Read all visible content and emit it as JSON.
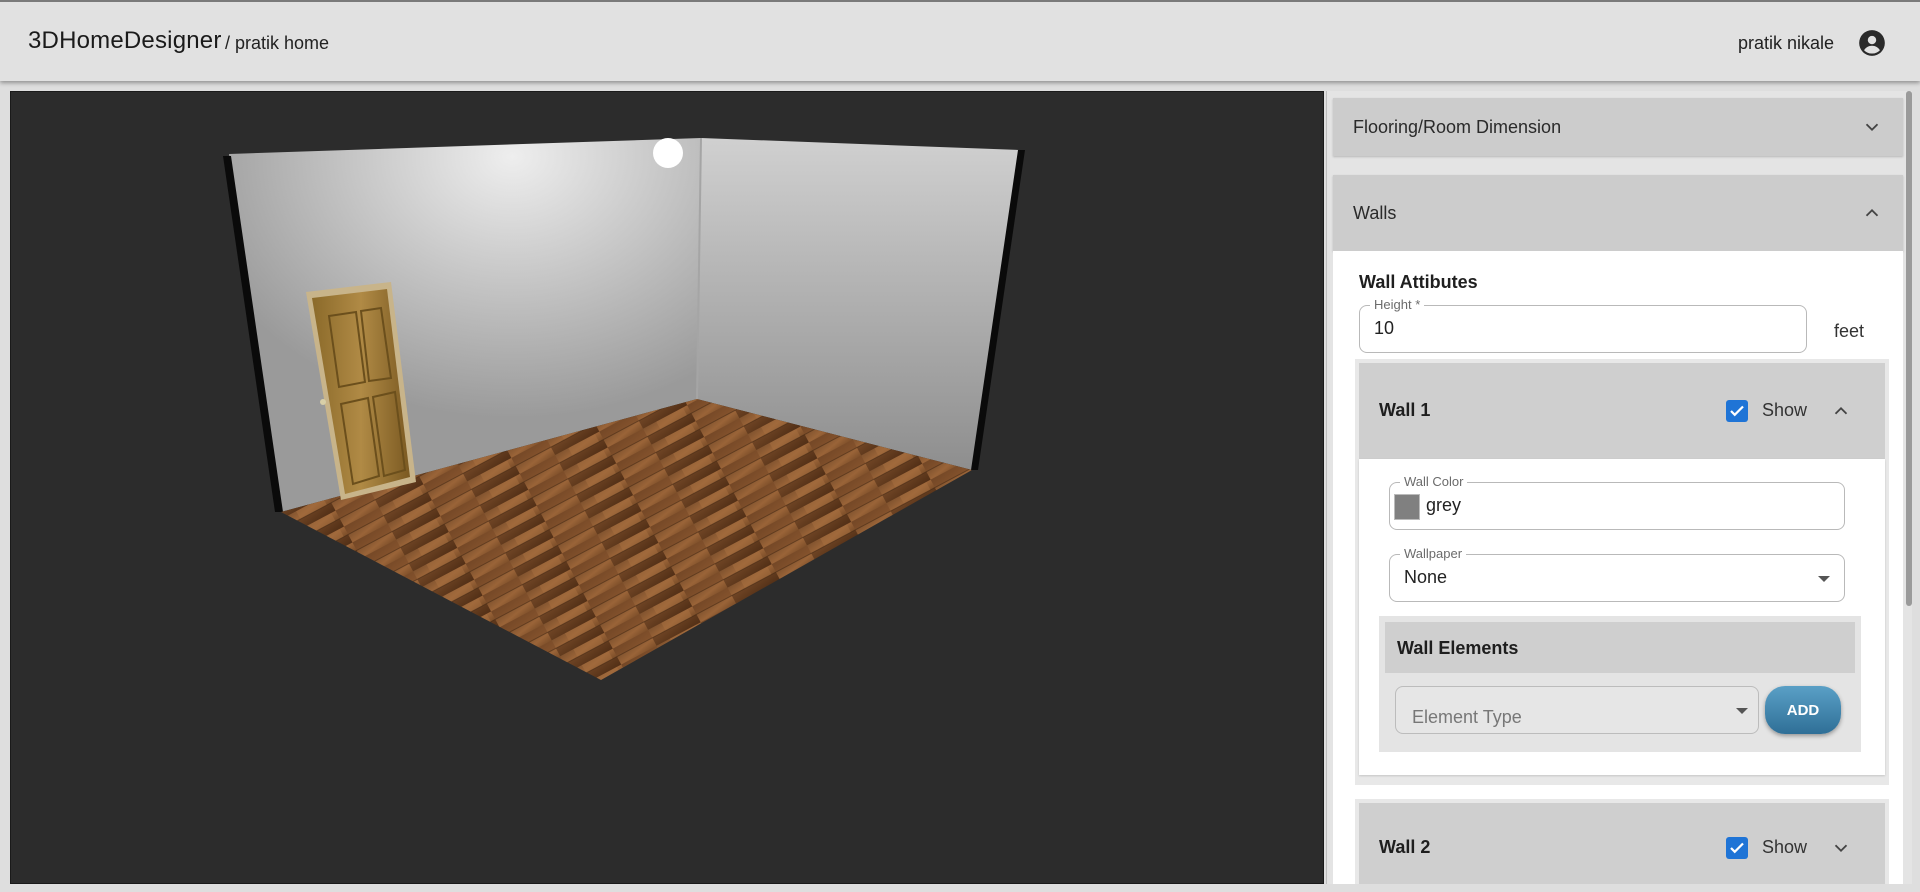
{
  "header": {
    "app_name": "3DHomeDesigner",
    "breadcrumb": "/ pratik home",
    "user_name": "pratik nikale",
    "account_icon": "account-circle-icon"
  },
  "viewport": {
    "description_icons": [
      "light-handle"
    ],
    "scene": "3d-room"
  },
  "panel": {
    "flooring": {
      "title": "Flooring/Room Dimension",
      "expanded": false
    },
    "walls": {
      "title": "Walls",
      "expanded": true,
      "attributes_title": "Wall Attibutes",
      "height": {
        "label": "Height *",
        "value": "10",
        "unit": "feet"
      },
      "items": [
        {
          "title": "Wall 1",
          "show_label": "Show",
          "show_checked": true,
          "expanded": true,
          "color": {
            "label": "Wall Color",
            "value": "grey",
            "swatch": "#808080"
          },
          "wallpaper": {
            "label": "Wallpaper",
            "value": "None"
          },
          "elements": {
            "title": "Wall Elements",
            "type_placeholder": "Element Type",
            "add_label": "ADD"
          }
        },
        {
          "title": "Wall 2",
          "show_label": "Show",
          "show_checked": true,
          "expanded": false
        }
      ]
    }
  },
  "colors": {
    "accent": "#1f74d6",
    "add_button": "#3a7fa8",
    "viewport_bg": "#2c2c2c"
  }
}
